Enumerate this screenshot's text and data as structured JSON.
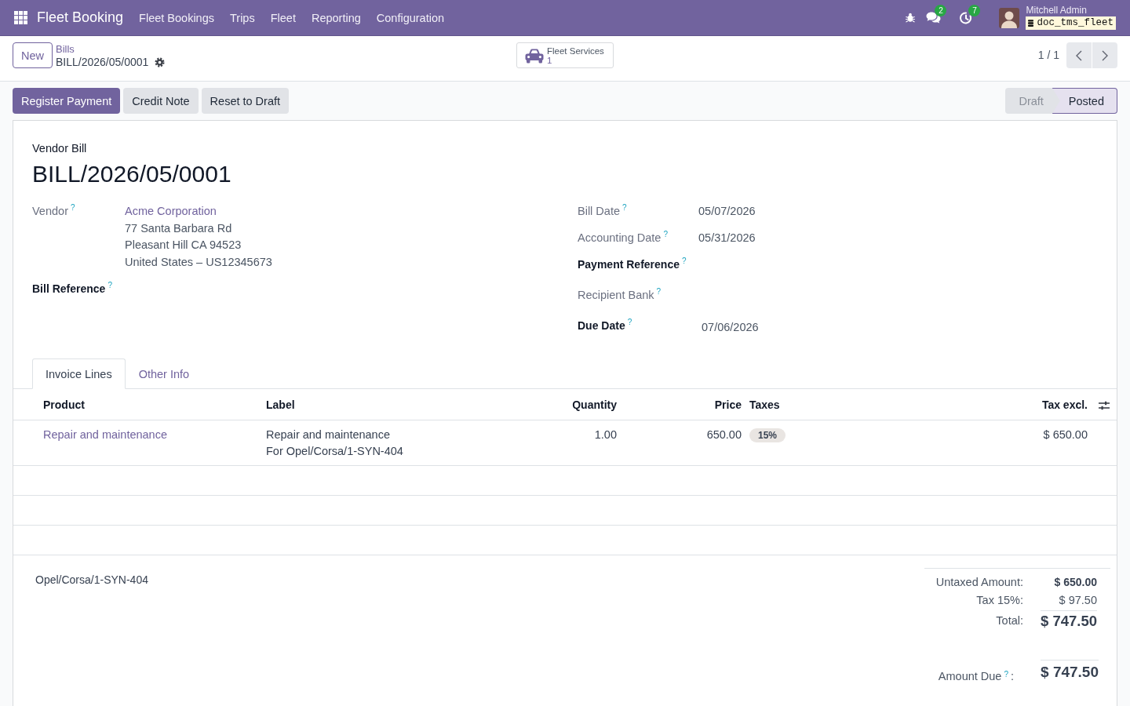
{
  "navbar": {
    "app_name": "Fleet Booking",
    "menu": [
      "Fleet Bookings",
      "Trips",
      "Fleet",
      "Reporting",
      "Configuration"
    ],
    "messages_count": "2",
    "activities_count": "7",
    "user_name": "Mitchell Admin",
    "database": "doc_tms_fleet"
  },
  "control_panel": {
    "new_button": "New",
    "breadcrumb": "Bills",
    "record_name": "BILL/2026/05/0001",
    "smart_button": {
      "label": "Fleet Services",
      "count": "1"
    },
    "pager": "1 / 1"
  },
  "actions": [
    {
      "label": "Register Payment",
      "kind": "primary"
    },
    {
      "label": "Credit Note",
      "kind": "secondary"
    },
    {
      "label": "Reset to Draft",
      "kind": "secondary"
    }
  ],
  "status_steps": [
    {
      "label": "Draft",
      "selected": false
    },
    {
      "label": "Posted",
      "selected": true
    }
  ],
  "form": {
    "type_label": "Vendor Bill",
    "title": "BILL/2026/05/0001",
    "left_fields": [
      {
        "label": "Vendor",
        "help": "?",
        "required": false,
        "link": "Acme Corporation",
        "lines": [
          "77 Santa Barbara Rd",
          "Pleasant Hill CA 94523",
          "United States – US12345673"
        ]
      },
      {
        "label": "Bill Reference",
        "help": "?",
        "required": true
      }
    ],
    "right_fields": [
      {
        "label": "Bill Date",
        "help": "?",
        "required": false,
        "value": "05/07/2026"
      },
      {
        "label": "Accounting Date",
        "help": "?",
        "required": false,
        "value": "05/31/2026"
      },
      {
        "label": "Payment Reference",
        "help": "?",
        "required": true
      },
      {
        "label": "Recipient Bank",
        "help": "?",
        "required": false
      },
      {
        "label": "Due Date",
        "help": "?",
        "required": true,
        "value": "07/06/2026"
      }
    ]
  },
  "tabs": [
    {
      "label": "Invoice Lines",
      "selected": true
    },
    {
      "label": "Other Info",
      "selected": false
    }
  ],
  "invoice_lines": {
    "columns": [
      {
        "label": "Product",
        "kind": "text"
      },
      {
        "label": "Label",
        "kind": "text"
      },
      {
        "label": "Quantity",
        "kind": "number"
      },
      {
        "label": "Price",
        "kind": "number"
      },
      {
        "label": "Taxes",
        "kind": "tags"
      },
      {
        "label": "Tax excl.",
        "kind": "number"
      }
    ],
    "rows": [
      {
        "product": "Repair and maintenance",
        "label": [
          "Repair and maintenance",
          "For Opel/Corsa/1-SYN-404"
        ],
        "quantity": "1.00",
        "price": "650.00",
        "taxes": [
          "15%"
        ],
        "subtotal": "$ 650.00"
      }
    ]
  },
  "narration": "Opel/Corsa/1-SYN-404",
  "totals": [
    {
      "label": "Untaxed Amount:",
      "value": "$ 650.00",
      "kind": "subtotal"
    },
    {
      "label": "Tax 15%:",
      "value": "$ 97.50",
      "kind": "tax"
    },
    {
      "label": "Total:",
      "value": "$ 747.50",
      "kind": "total"
    }
  ],
  "amount_due": {
    "label": "Amount Due",
    "help": "?",
    "separator": ":",
    "value": "$ 747.50"
  }
}
